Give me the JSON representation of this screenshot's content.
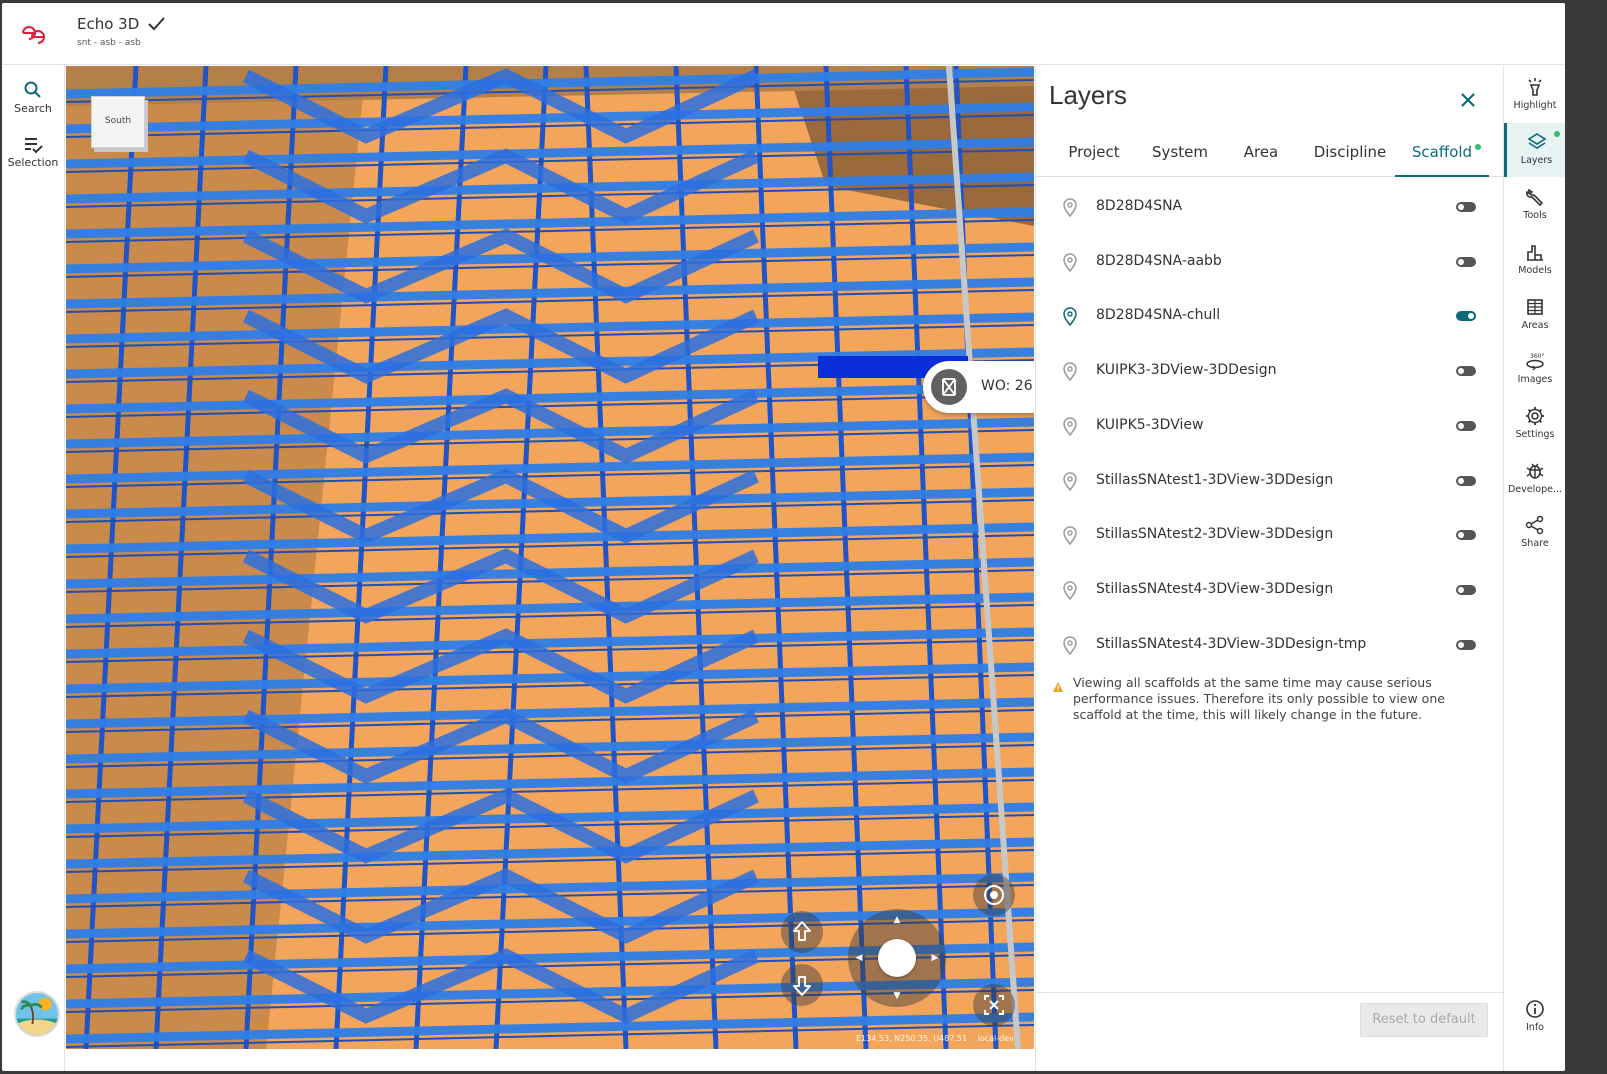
{
  "header": {
    "app_title": "Echo 3D",
    "subtitle": "snt - asb - asb"
  },
  "left_rail": {
    "items": [
      {
        "label": "Search",
        "icon": "search-icon"
      },
      {
        "label": "Selection",
        "icon": "selection-icon"
      }
    ]
  },
  "viewport": {
    "navcube_label": "South",
    "work_order_label": "WO: 26",
    "coordinates": "E134.53, N250.35, U487.51",
    "environment": "local-dev"
  },
  "layers_panel": {
    "title": "Layers",
    "tabs": [
      {
        "label": "Project",
        "active": false
      },
      {
        "label": "System",
        "active": false
      },
      {
        "label": "Area",
        "active": false
      },
      {
        "label": "Discipline",
        "active": false
      },
      {
        "label": "Scaffold",
        "active": true,
        "indicator": true
      }
    ],
    "layers": [
      {
        "name": "8D28D4SNA",
        "enabled": false
      },
      {
        "name": "8D28D4SNA-aabb",
        "enabled": false
      },
      {
        "name": "8D28D4SNA-chull",
        "enabled": true
      },
      {
        "name": "KUIPK3-3DView-3DDesign",
        "enabled": false
      },
      {
        "name": "KUIPK5-3DView",
        "enabled": false
      },
      {
        "name": "StillasSNAtest1-3DView-3DDesign",
        "enabled": false
      },
      {
        "name": "StillasSNAtest2-3DView-3DDesign",
        "enabled": false
      },
      {
        "name": "StillasSNAtest4-3DView-3DDesign",
        "enabled": false
      },
      {
        "name": "StillasSNAtest4-3DView-3DDesign-tmp",
        "enabled": false
      }
    ],
    "warning": "Viewing all scaffolds at the same time may cause serious performance issues. Therefore its only possible to view one scaffold at the time, this will likely change in the future.",
    "reset_label": "Reset to default"
  },
  "right_rail": {
    "items": [
      {
        "label": "Highlight",
        "icon": "highlight-icon"
      },
      {
        "label": "Layers",
        "icon": "layers-icon",
        "active": true
      },
      {
        "label": "Tools",
        "icon": "tools-icon"
      },
      {
        "label": "Models",
        "icon": "models-icon"
      },
      {
        "label": "Areas",
        "icon": "areas-icon"
      },
      {
        "label": "Images",
        "icon": "images-360-icon"
      },
      {
        "label": "Settings",
        "icon": "settings-icon"
      },
      {
        "label": "Develope...",
        "icon": "developer-bug-icon"
      },
      {
        "label": "Share",
        "icon": "share-icon"
      },
      {
        "label": "Info",
        "icon": "info-icon"
      }
    ]
  },
  "colors": {
    "accent": "#0c6b7a",
    "status_dot": "#2fbf71",
    "scaffold_blue": "#2f7fe8",
    "background_orange": "#f2a55b",
    "logo_red": "#e0203c"
  }
}
